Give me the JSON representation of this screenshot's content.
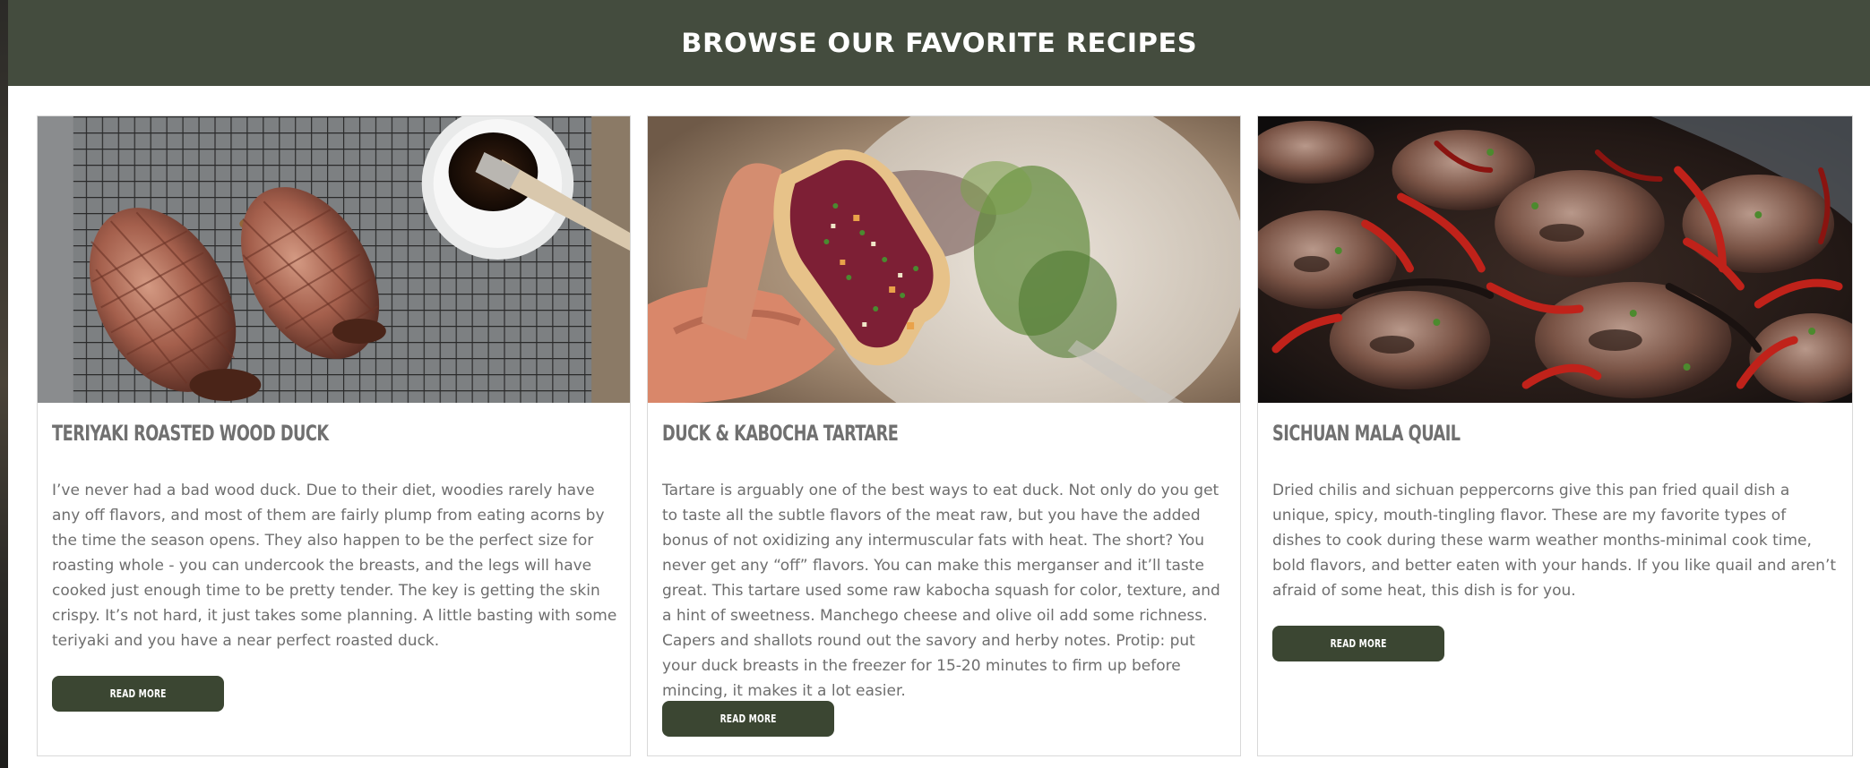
{
  "section": {
    "heading": "BROWSE OUR FAVORITE RECIPES"
  },
  "cards": [
    {
      "title": "TERIYAKI ROASTED WOOD DUCK",
      "description": "I’ve never had a bad wood duck. Due to their diet, woodies rarely have any off flavors, and most of them are fairly plump from eating acorns by the time the season opens. They also happen to be the perfect size for roasting whole - you can undercook the breasts, and the legs will have cooked just enough time to be pretty tender. The key is getting the skin crispy. It’s not hard, it just takes some planning. A little basting with some teriyaki and you have a near perfect roasted duck.",
      "button_label": "READ MORE",
      "image": "roasted-duck-photo"
    },
    {
      "title": "DUCK & KABOCHA TARTARE",
      "description": "Tartare is arguably one of the best ways to eat duck. Not only do you get to taste all the subtle flavors of the meat raw, but you have the added bonus of not oxidizing any intermuscular fats with heat. The short? You never get any “off” flavors. You can make this merganser and it’ll taste great. This tartare used some raw kabocha squash for color, texture, and a hint of sweetness. Manchego cheese and olive oil add some richness. Capers and shallots round out the savory and herby notes. Protip: put your duck breasts in the freezer for 15-20 minutes to firm up before mincing, it makes it a lot easier.",
      "button_label": "READ MORE",
      "image": "tartare-toast-photo"
    },
    {
      "title": "SICHUAN MALA QUAIL",
      "description": "Dried chilis and sichuan peppercorns give this pan fried quail dish a unique, spicy, mouth-tingling flavor. These are my favorite types of dishes to cook during these warm weather months-minimal cook time, bold flavors, and better eaten with your hands. If you like quail and aren’t afraid of some heat, this dish is for you.",
      "button_label": "READ MORE",
      "image": "mala-quail-photo"
    }
  ],
  "colors": {
    "banner": "#444c3e",
    "button": "#3b4632",
    "title_text": "#707070",
    "body_text": "#6e6e6e"
  }
}
